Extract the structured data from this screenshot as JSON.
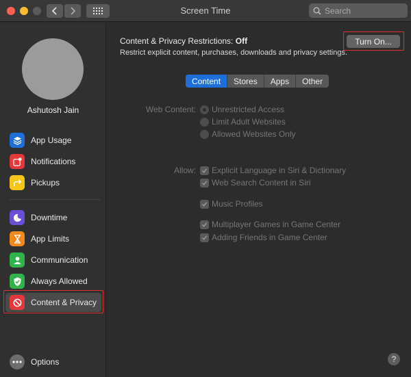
{
  "window": {
    "title": "Screen Time"
  },
  "search": {
    "placeholder": "Search"
  },
  "user": {
    "name": "Ashutosh Jain"
  },
  "sidebar": {
    "items": [
      {
        "label": "App Usage",
        "icon": "layers-icon",
        "color": "#1f6fd6"
      },
      {
        "label": "Notifications",
        "icon": "notification-icon",
        "color": "#e5383b"
      },
      {
        "label": "Pickups",
        "icon": "pickup-arrow-icon",
        "color": "#f5c518"
      },
      {
        "label": "Downtime",
        "icon": "moon-clock-icon",
        "color": "#6a4fd6"
      },
      {
        "label": "App Limits",
        "icon": "hourglass-icon",
        "color": "#f08a1c"
      },
      {
        "label": "Communication",
        "icon": "person-icon",
        "color": "#2fb34a"
      },
      {
        "label": "Always Allowed",
        "icon": "checkmark-shield-icon",
        "color": "#2fb34a"
      },
      {
        "label": "Content & Privacy",
        "icon": "no-entry-icon",
        "color": "#e5383b",
        "selected": true
      }
    ],
    "options_label": "Options"
  },
  "header": {
    "title_prefix": "Content & Privacy Restrictions:",
    "title_status": "Off",
    "subtitle": "Restrict explicit content, purchases, downloads and privacy settings.",
    "turn_on_label": "Turn On..."
  },
  "tabs": [
    {
      "label": "Content",
      "active": true
    },
    {
      "label": "Stores",
      "active": false
    },
    {
      "label": "Apps",
      "active": false
    },
    {
      "label": "Other",
      "active": false
    }
  ],
  "web_content": {
    "label": "Web Content:",
    "options": [
      {
        "label": "Unrestricted Access",
        "selected": true
      },
      {
        "label": "Limit Adult Websites",
        "selected": false
      },
      {
        "label": "Allowed Websites Only",
        "selected": false
      }
    ]
  },
  "allow": {
    "label": "Allow:",
    "options": [
      {
        "label": "Explicit Language in Siri & Dictionary",
        "checked": true
      },
      {
        "label": "Web Search Content in Siri",
        "checked": true
      },
      {
        "label": "Music Profiles",
        "checked": true
      },
      {
        "label": "Multiplayer Games in Game Center",
        "checked": true
      },
      {
        "label": "Adding Friends in Game Center",
        "checked": true
      }
    ]
  },
  "help_label": "?"
}
